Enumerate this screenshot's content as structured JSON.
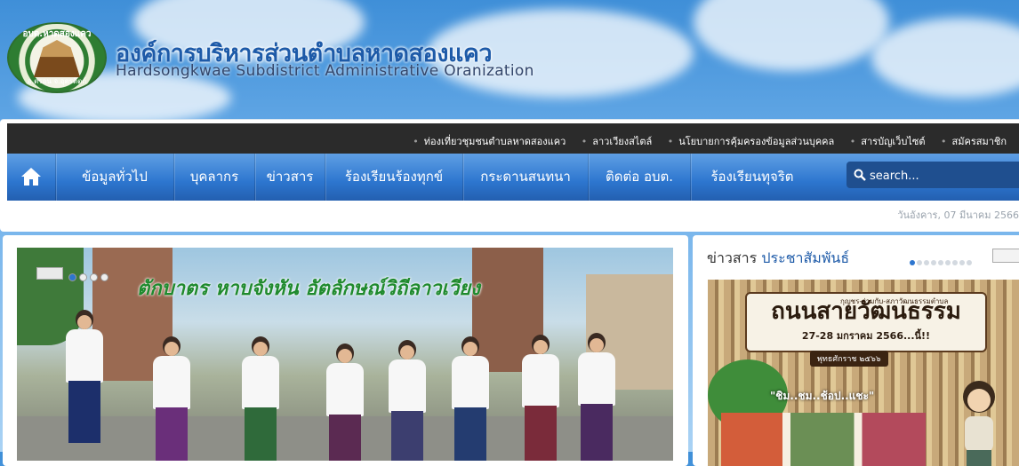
{
  "header": {
    "logo_text_top": "อบต.หาดสองแคว",
    "logo_text_bottom": "อ.ตรอน จ.อุตรดิตถ์",
    "title": "องค์การบริหารส่วนตำบลหาดสองแคว",
    "subtitle": "Hardsongkwae Subdistrict Administrative Oranization"
  },
  "topbar": {
    "links": [
      "ท่องเที่ยวชุมชนตำบลหาดสองแคว",
      "ลาวเวียงสไตล์",
      "นโยบายการคุ้มครองข้อมูลส่วนบุคคล",
      "สารบัญเว็บไซต์",
      "สมัครสมาชิก"
    ]
  },
  "mainnav": {
    "home_icon": "home-icon",
    "items": [
      "ข้อมูลทั่วไป",
      "บุคลากร",
      "ข่าวสาร",
      "ร้องเรียนร้องทุกข์",
      "กระดานสนทนา",
      "ติดต่อ อบต.",
      "ร้องเรียนทุจริต"
    ],
    "search_placeholder": "search..."
  },
  "date": "วันอังคาร, 07 มีนาคม 2566",
  "slider": {
    "caption": "ตักบาตร หาบจังหัน อัตลักษณ์วิถีลาวเวียง",
    "dots": 4,
    "active_dot": 0
  },
  "news": {
    "title_main": "ข่าวสาร",
    "title_accent": "ประชาสัมพันธ์",
    "dots": 9,
    "active_dot": 0,
    "banner_top": "กุญชร-ร่วมกับ-สภาวัฒนธรรมตำบล",
    "banner_title": "ถนนสายวัฒนธรรม",
    "banner_date": "27-28 มกราคม 2566...นี้!!",
    "banner_year": "พุทธศักราช ๒๕๖๖",
    "tagline": "\"ชิม..ชม..ช้อป..แชะ\""
  },
  "colors": {
    "brand_blue": "#2d76cf",
    "title_blue": "#1d5aa8",
    "topbar": "#2b2b2b",
    "slider_caption_green": "#1f8a2e"
  }
}
